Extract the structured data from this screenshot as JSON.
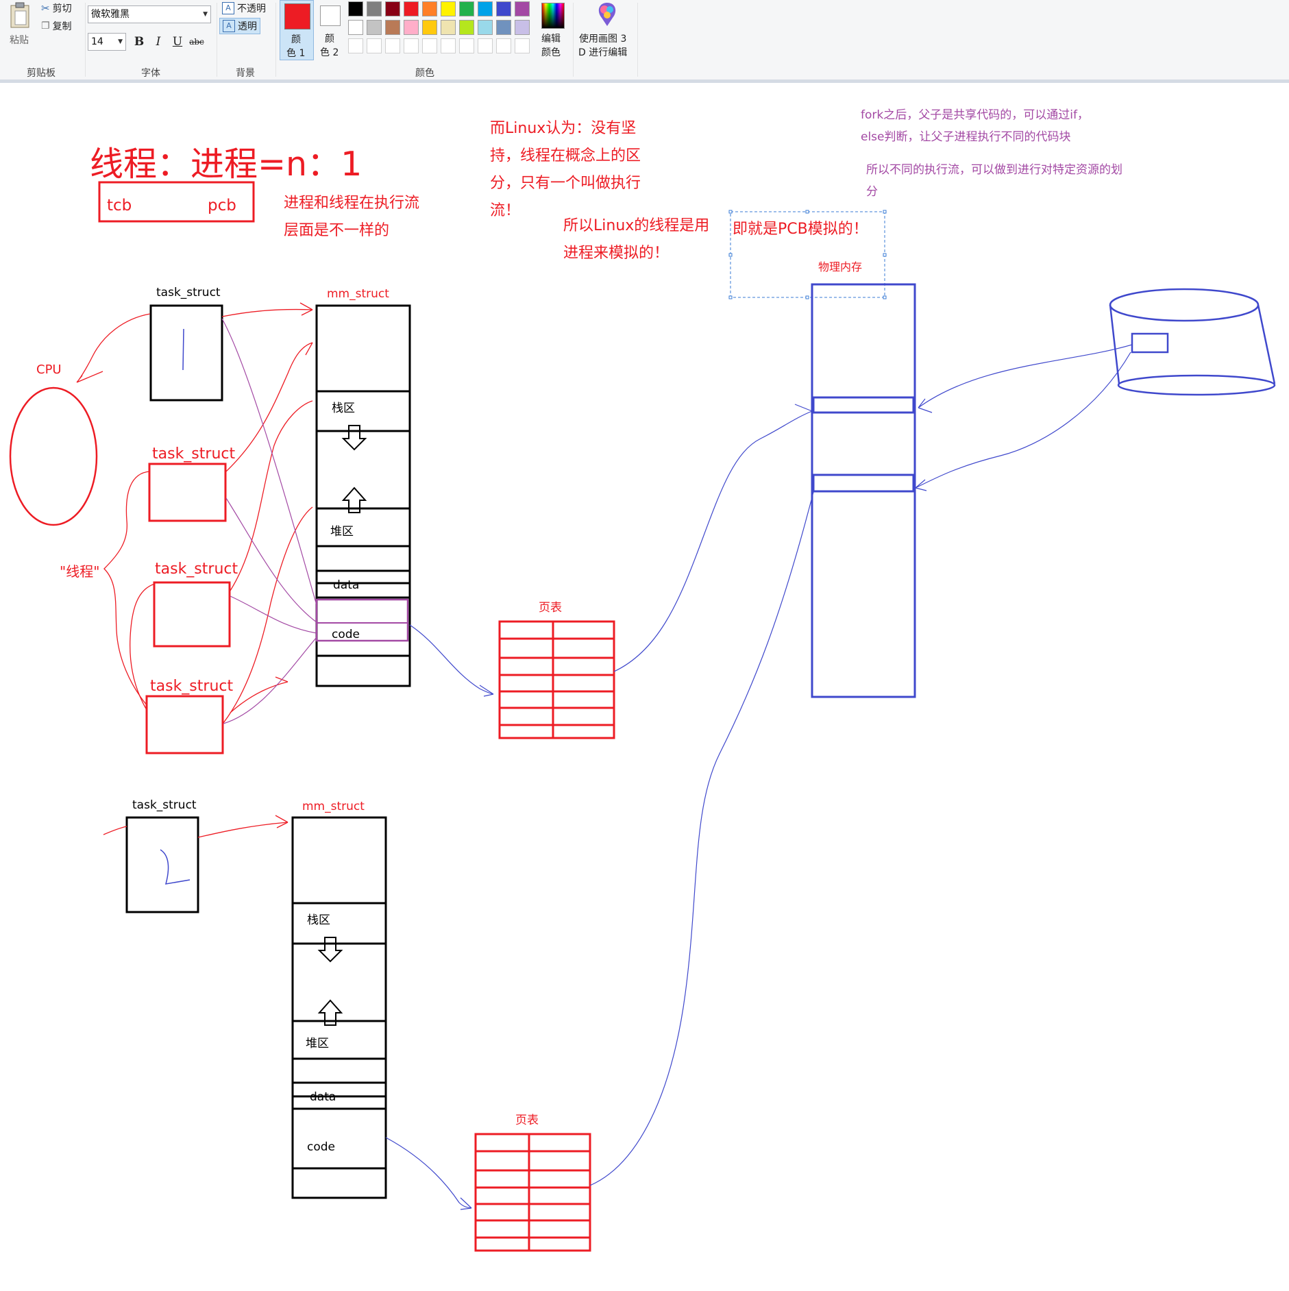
{
  "ribbon": {
    "clipboard": {
      "paste_label": "粘贴",
      "cut_label": "剪切",
      "copy_label": "复制",
      "group_label": "剪贴板"
    },
    "font": {
      "family_value": "微软雅黑",
      "size_value": "14",
      "bold_label": "B",
      "italic_label": "I",
      "underline_label": "U",
      "strike_label": "abc",
      "group_label": "字体"
    },
    "background": {
      "opaque_label": "不透明",
      "transparent_label": "透明",
      "group_label": "背景"
    },
    "colors": {
      "color1_label_line1": "颜",
      "color1_label_line2": "色 1",
      "color2_label_line1": "颜",
      "color2_label_line2": "色 2",
      "edit_colors_line1": "编辑",
      "edit_colors_line2": "颜色",
      "paint3d_line1": "使用画图 3",
      "paint3d_line2": "D 进行编辑",
      "group_label": "颜色",
      "color1_value": "#ed1c24",
      "color2_value": "#ffffff",
      "palette_row1": [
        "#000000",
        "#7f7f7f",
        "#880015",
        "#ed1c24",
        "#ff7f27",
        "#fff200",
        "#22b14c",
        "#00a2e8",
        "#3f48cc",
        "#a349a4"
      ],
      "palette_row2": [
        "#ffffff",
        "#c3c3c3",
        "#b97a57",
        "#ffaec9",
        "#ffc90e",
        "#efe4b0",
        "#b5e61d",
        "#99d9ea",
        "#7092be",
        "#c8bfe7"
      ],
      "palette_row3": [
        "#ffffff",
        "#ffffff",
        "#ffffff",
        "#ffffff",
        "#ffffff",
        "#ffffff",
        "#ffffff",
        "#ffffff",
        "#ffffff",
        "#ffffff"
      ]
    }
  },
  "canvas": {
    "title": "线程：进程=n：1",
    "tcb": "tcb",
    "pcb": "pcb",
    "note_exec_flow": [
      "进程和线程在执行流",
      "层面是不一样的"
    ],
    "note_linux": [
      "而Linux认为：没有坚",
      "持，线程在概念上的区",
      "分，只有一个叫做执行",
      "流！"
    ],
    "note_linux_sim": [
      "所以Linux的线程是用",
      "进程来模拟的！"
    ],
    "note_pcb_sim": "即就是PCB模拟的！",
    "note_fork": [
      "fork之后，父子是共享代码的，可以通过if，",
      "else判断，让父子进程执行不同的代码块"
    ],
    "note_flow": [
      "所以不同的执行流，可以做到进行对特定资源的划",
      "分"
    ],
    "physical_memory": "物理内存",
    "cpu": "CPU",
    "thread_quote": "\"线程\"",
    "task_struct": "task_struct",
    "mm_struct": "mm_struct",
    "stack_area": "栈区",
    "heap_area": "堆区",
    "data_area": "data",
    "code_area": "code",
    "page_table": "页表"
  }
}
